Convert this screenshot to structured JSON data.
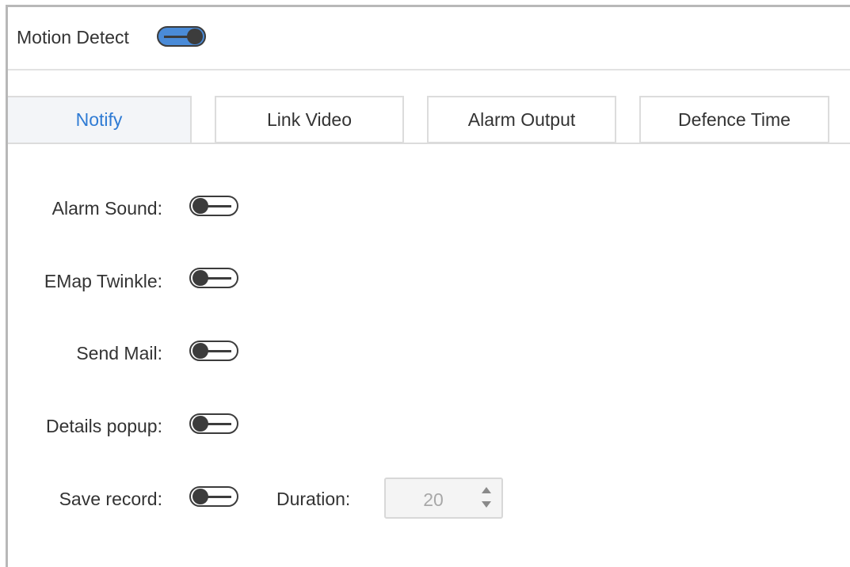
{
  "header": {
    "motion_detect_label": "Motion Detect",
    "motion_detect_enabled": true
  },
  "tabs": [
    {
      "label": "Notify",
      "active": true
    },
    {
      "label": "Link Video",
      "active": false
    },
    {
      "label": "Alarm Output",
      "active": false
    },
    {
      "label": "Defence Time",
      "active": false
    }
  ],
  "notify": {
    "alarm_sound": {
      "label": "Alarm Sound:",
      "enabled": false
    },
    "emap_twinkle": {
      "label": "EMap Twinkle:",
      "enabled": false
    },
    "send_mail": {
      "label": "Send Mail:",
      "enabled": false
    },
    "details_popup": {
      "label": "Details popup:",
      "enabled": false
    },
    "save_record": {
      "label": "Save record:",
      "enabled": false
    },
    "duration": {
      "label": "Duration:",
      "value": "20"
    }
  },
  "colors": {
    "accent": "#2f7bd4",
    "toggle_on": "#4a8bd8",
    "toggle_knob": "#3c3c3c"
  }
}
